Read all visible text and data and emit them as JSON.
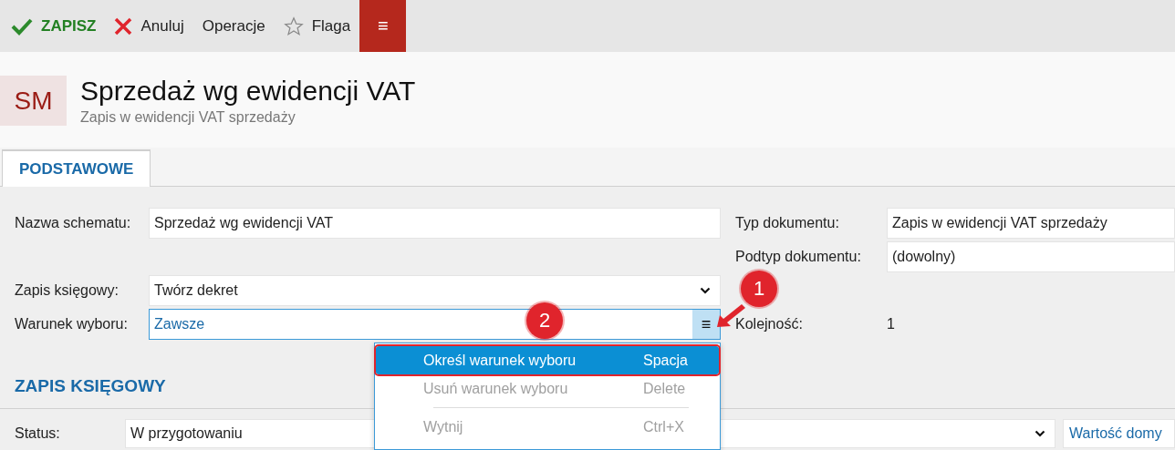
{
  "toolbar": {
    "buttons": [
      {
        "kind": "save",
        "label": "ZAPISZ"
      },
      {
        "kind": "cancel",
        "label": "Anuluj"
      },
      {
        "kind": "plain",
        "label": "Operacje"
      },
      {
        "kind": "flag",
        "label": "Flaga"
      },
      {
        "kind": "menu",
        "label": "≡"
      }
    ]
  },
  "header": {
    "badge": "SM",
    "title": "Sprzedaż wg ewidencji VAT",
    "subtitle": "Zapis w ewidencji VAT sprzedaży"
  },
  "tabs": [
    {
      "label": "PODSTAWOWE",
      "selected": true
    }
  ],
  "form": {
    "rows": [
      {
        "left": {
          "label": "Nazwa schematu:",
          "kind": "text",
          "value": "Sprzedaż wg ewidencji VAT"
        },
        "right": {
          "label": "Typ dokumentu:",
          "kind": "text",
          "value": "Zapis w ewidencji VAT sprzedaży"
        }
      },
      {
        "right": {
          "label": "Podtyp dokumentu:",
          "kind": "text",
          "value": "(dowolny)"
        }
      },
      {
        "left": {
          "label": "Zapis księgowy:",
          "kind": "select",
          "value": "Twórz dekret"
        }
      },
      {
        "left": {
          "label": "Warunek wyboru:",
          "kind": "picker",
          "value": "Zawsze",
          "focused": true,
          "button": "≡"
        },
        "right": {
          "label": "Kolejność:",
          "kind": "plain",
          "value": "1"
        }
      }
    ]
  },
  "section": {
    "title": "ZAPIS KSIĘGOWY",
    "rows": [
      {
        "label": "Status:",
        "kind": "select",
        "value": "W przygotowaniu",
        "link": "Wartość domy"
      }
    ]
  },
  "context_menu": {
    "items": [
      {
        "kind": "item",
        "label": "Określ warunek wyboru",
        "shortcut": "Spacja",
        "selected": true,
        "disabled": false,
        "annotated": true
      },
      {
        "kind": "item",
        "label": "Usuń warunek wyboru",
        "shortcut": "Delete",
        "selected": false,
        "disabled": true,
        "annotated": false
      },
      {
        "kind": "separator"
      },
      {
        "kind": "item",
        "label": "Wytnij",
        "shortcut": "Ctrl+X",
        "selected": false,
        "disabled": true,
        "annotated": false
      }
    ]
  },
  "annotations": [
    {
      "label": "2",
      "arrow": false
    },
    {
      "label": "1",
      "arrow": true
    }
  ]
}
